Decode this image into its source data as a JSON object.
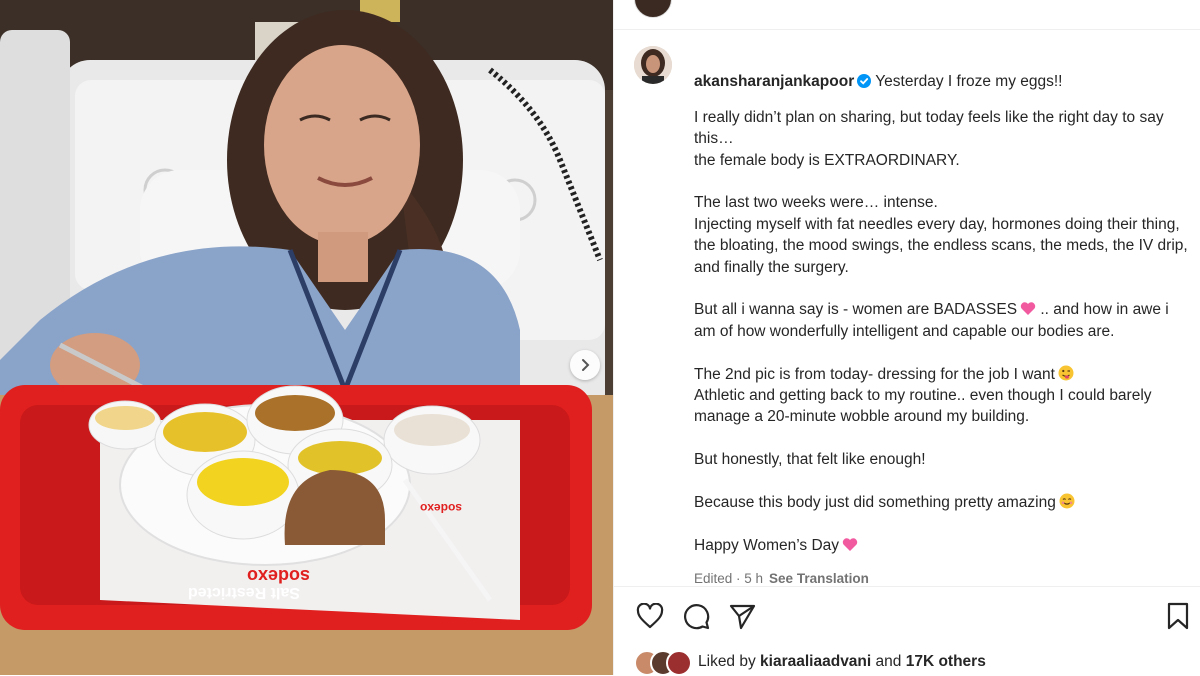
{
  "post": {
    "username": "akansharanjankapoor",
    "verified": true,
    "caption": {
      "first_line": "Yesterday I froze my eggs!!",
      "paragraphs": [
        "I really didn’t plan on sharing, but today feels like the right day to say this…\nthe female body is EXTRAORDINARY.",
        "The last two weeks were… intense.\nInjecting myself with fat needles every day, hormones doing their thing, the bloating, the mood swings, the endless scans, the meds, the IV drip, and finally the surgery.",
        "But all i wanna say is - women are BADASSES",
        "The 2nd pic is from today- dressing for the job I want",
        "But honestly, that felt like enough!",
        "Because this body just did something pretty amazing",
        "Happy Women’s Day"
      ],
      "p3_cont": " .. and how in awe i am of how wonderfully intelligent and capable our bodies are.",
      "p4_cont": "\nAthletic and getting back to my routine.. even though I could barely manage a 20-minute wobble around my building."
    },
    "meta": {
      "edited": "Edited · 5 h",
      "see_translation": "See Translation"
    },
    "likes": {
      "prefix": "Liked by ",
      "user": "kiaraaliaadvani",
      "middle": " and ",
      "count": "17K others"
    }
  },
  "photo": {
    "tray_brand": "sodexo",
    "tray_label": "Salt Restricted",
    "tray_logo_small": "sodexo"
  },
  "icons": {
    "like": "heart-icon",
    "comment": "comment-icon",
    "share": "send-icon",
    "save": "bookmark-icon",
    "verified": "verified-badge-icon",
    "next": "chevron-right-icon"
  },
  "colors": {
    "verified": "#0095f6",
    "tray": "#e0201e",
    "text": "#262626",
    "muted": "#737373"
  }
}
